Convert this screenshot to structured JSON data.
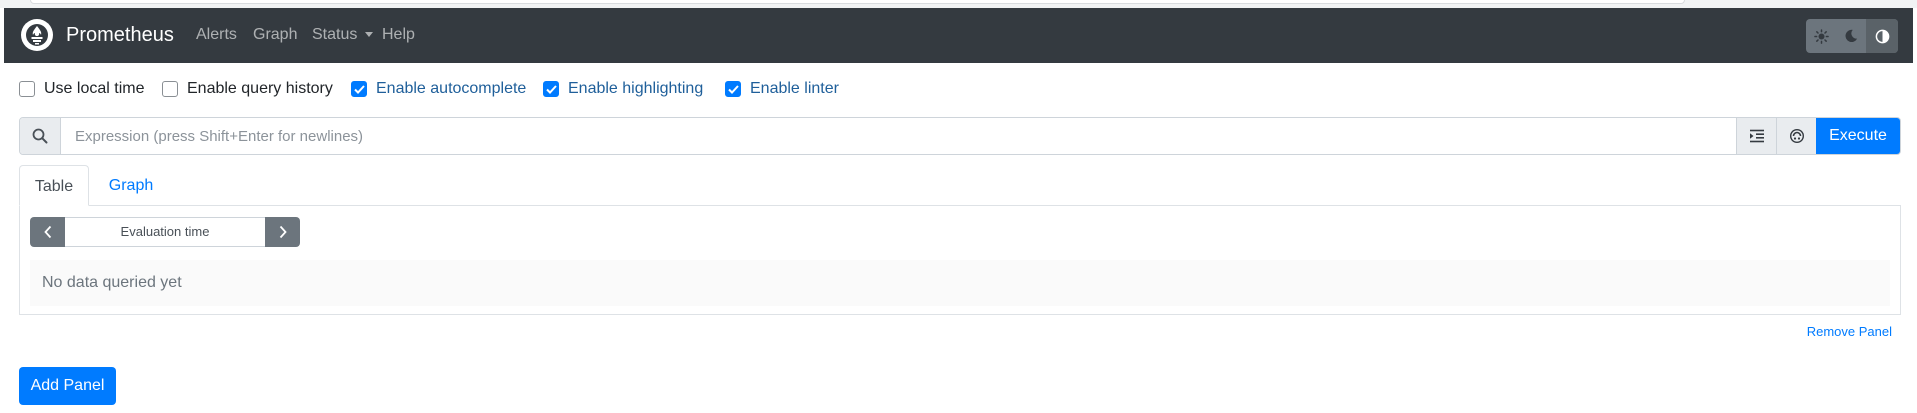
{
  "navbar": {
    "brand": "Prometheus",
    "links": [
      "Alerts",
      "Graph",
      "Status",
      "Help"
    ],
    "theme_icons": [
      "sun-icon",
      "moon-icon",
      "contrast-icon"
    ]
  },
  "options": [
    {
      "label": "Use local time",
      "checked": false
    },
    {
      "label": "Enable query history",
      "checked": false
    },
    {
      "label": "Enable autocomplete",
      "checked": true
    },
    {
      "label": "Enable highlighting",
      "checked": true
    },
    {
      "label": "Enable linter",
      "checked": true
    }
  ],
  "expression": {
    "placeholder": "Expression (press Shift+Enter for newlines)",
    "value": "",
    "execute_label": "Execute"
  },
  "tabs": [
    {
      "label": "Table",
      "active": true
    },
    {
      "label": "Graph",
      "active": false
    }
  ],
  "table_panel": {
    "evaluation_time_label": "Evaluation time",
    "empty_message": "No data queried yet"
  },
  "remove_panel_label": "Remove Panel",
  "add_panel_label": "Add Panel",
  "colors": {
    "navbar": "#343a40",
    "primary": "#007bff",
    "secondary": "#6c757d"
  }
}
